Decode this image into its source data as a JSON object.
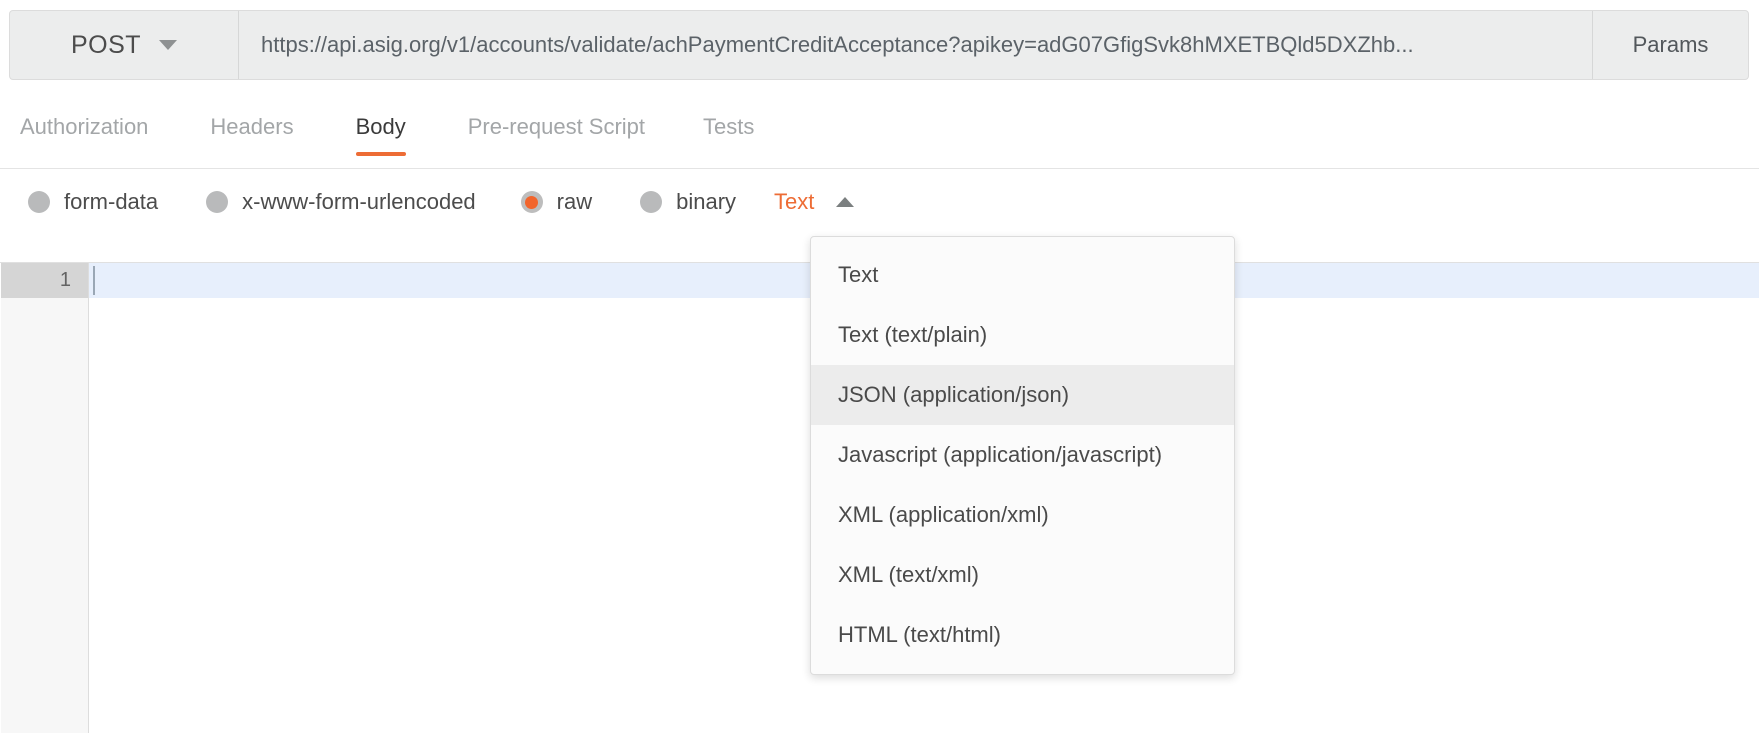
{
  "request_bar": {
    "method": "POST",
    "method_caret_icon": "chevron-down-icon",
    "url": "https://api.asig.org/v1/accounts/validate/achPaymentCreditAcceptance?apikey=adG07GfigSvk8hMXETBQld5DXZhb...",
    "params_label": "Params"
  },
  "tabs": [
    {
      "label": "Authorization",
      "active": false
    },
    {
      "label": "Headers",
      "active": false
    },
    {
      "label": "Body",
      "active": true
    },
    {
      "label": "Pre-request Script",
      "active": false
    },
    {
      "label": "Tests",
      "active": false
    }
  ],
  "body_types": [
    {
      "label": "form-data",
      "selected": false
    },
    {
      "label": "x-www-form-urlencoded",
      "selected": false
    },
    {
      "label": "raw",
      "selected": true
    },
    {
      "label": "binary",
      "selected": false
    }
  ],
  "type_select": {
    "value": "Text",
    "caret_icon": "chevron-up-icon",
    "open": true
  },
  "dropdown": {
    "items": [
      {
        "label": "Text",
        "hover": false
      },
      {
        "label": "Text (text/plain)",
        "hover": false
      },
      {
        "label": "JSON (application/json)",
        "hover": true
      },
      {
        "label": "Javascript (application/javascript)",
        "hover": false
      },
      {
        "label": "XML (application/xml)",
        "hover": false
      },
      {
        "label": "XML (text/xml)",
        "hover": false
      },
      {
        "label": "HTML (text/html)",
        "hover": false
      }
    ]
  },
  "editor": {
    "line_number": "1",
    "content": ""
  },
  "colors": {
    "accent": "#ed6c35",
    "radio_selected": "#f2652c",
    "active_line": "#e7effc",
    "gutter_bg": "#f7f7f7",
    "gutter_active": "#d5d5d5",
    "bar_bg": "#eceded",
    "muted_text": "#a3a6a8"
  }
}
